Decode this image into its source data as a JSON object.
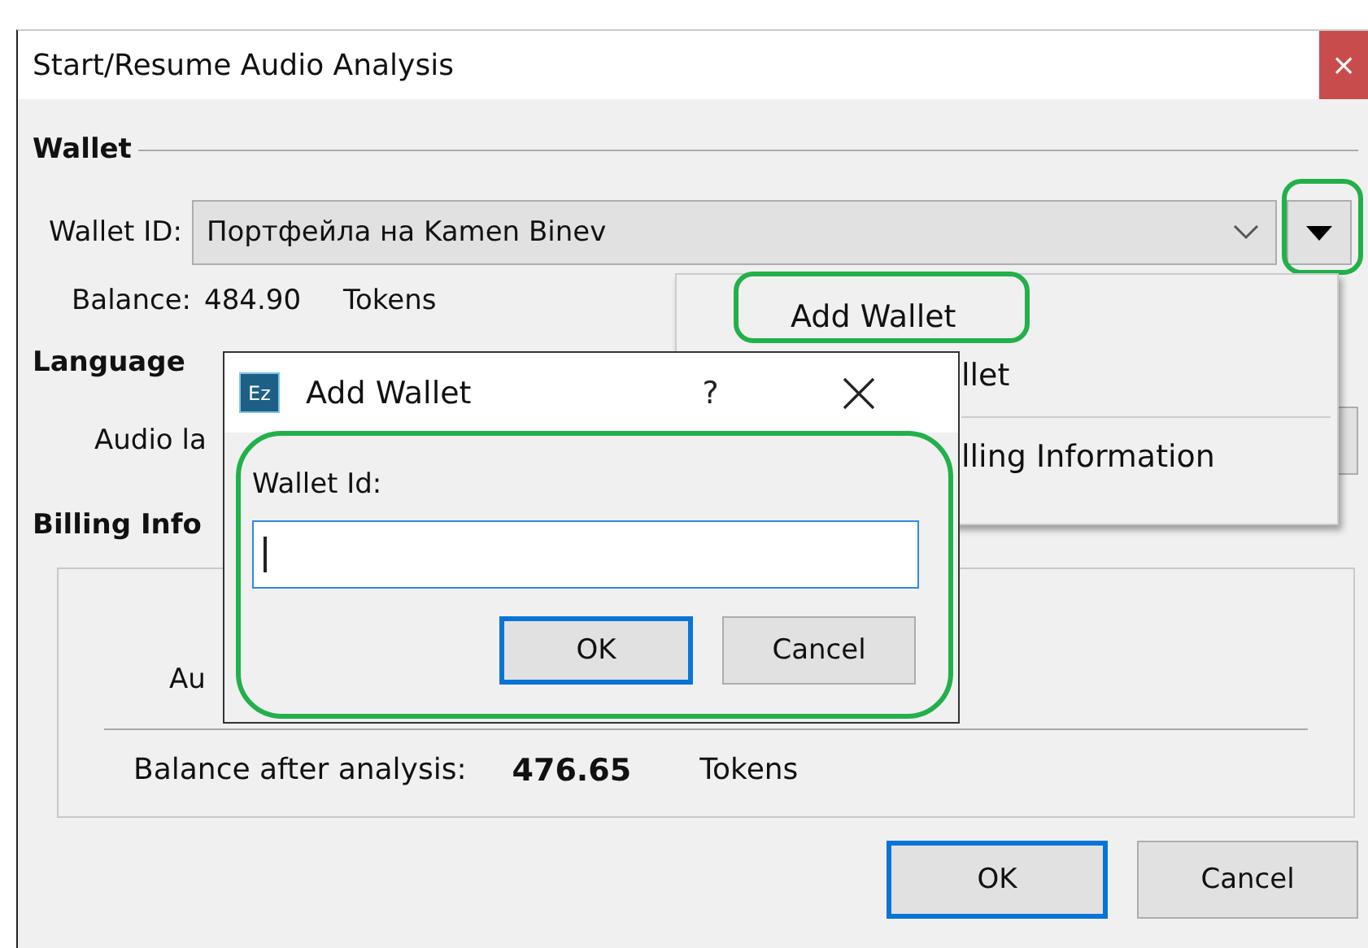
{
  "window": {
    "title": "Start/Resume Audio Analysis",
    "close": "×"
  },
  "wallet": {
    "heading": "Wallet",
    "id_label": "Wallet ID:",
    "id_value": "Портфейла на Kamen Binev",
    "balance_label": "Balance:",
    "balance_value": "484.90",
    "balance_unit": "Tokens"
  },
  "language": {
    "heading": "Language",
    "audio_label": "Audio la"
  },
  "billing": {
    "heading": "Billing Info",
    "row_label": "Au",
    "after_label": "Balance after analysis:",
    "after_value": "476.65",
    "after_unit": "Tokens"
  },
  "buttons": [
    {
      "label": "OK",
      "default": true
    },
    {
      "label": "Cancel",
      "default": false
    }
  ],
  "wallet_menu": {
    "items": [
      {
        "label": "Add Wallet",
        "separator_before": false,
        "cut": false
      },
      {
        "label": "llet",
        "separator_before": false,
        "cut": true
      },
      {
        "label": "lling Information",
        "separator_before": true,
        "cut": true
      }
    ]
  },
  "add_wallet_dialog": {
    "logo": "Ez",
    "title": "Add Wallet",
    "help": "?",
    "field_label": "Wallet Id:",
    "buttons": [
      {
        "label": "OK",
        "default": true
      },
      {
        "label": "Cancel",
        "default": false
      }
    ]
  }
}
